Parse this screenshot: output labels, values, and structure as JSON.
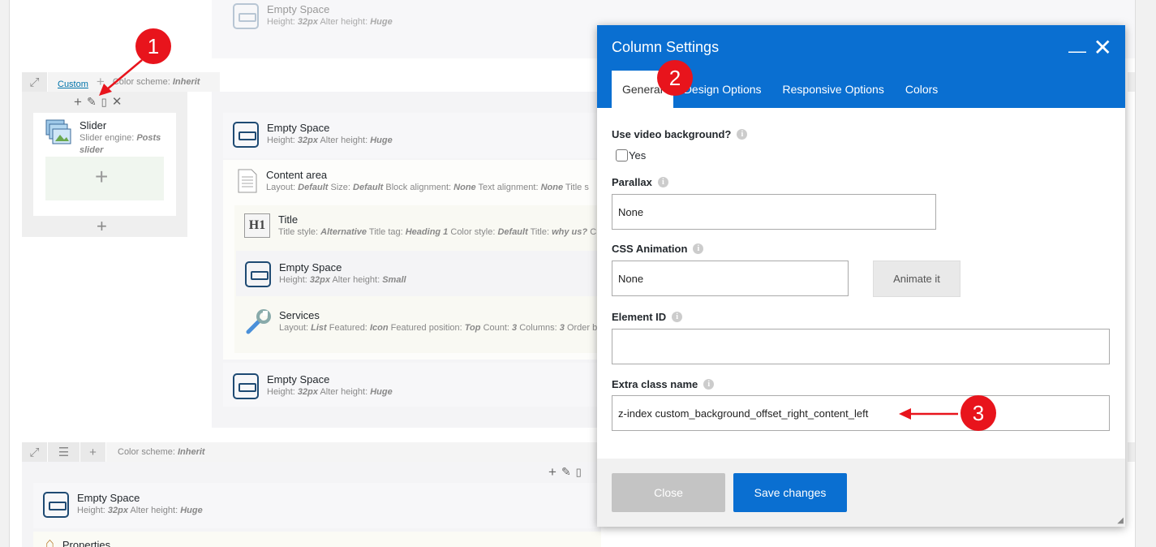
{
  "modal": {
    "title": "Column Settings",
    "tabs": [
      {
        "label": "General",
        "active": true
      },
      {
        "label": "Design Options",
        "active": false
      },
      {
        "label": "Responsive Options",
        "active": false
      },
      {
        "label": "Colors",
        "active": false
      }
    ],
    "fields": {
      "video_bg": {
        "label": "Use video background?",
        "checkbox_label": "Yes",
        "checked": false
      },
      "parallax": {
        "label": "Parallax",
        "value": "None"
      },
      "css_animation": {
        "label": "CSS Animation",
        "value": "None",
        "button": "Animate it"
      },
      "element_id": {
        "label": "Element ID",
        "value": ""
      },
      "extra_class": {
        "label": "Extra class name",
        "value": "z-index custom_background_offset_right_content_left"
      }
    },
    "footer": {
      "close_label": "Close",
      "save_label": "Save changes"
    },
    "header_color": "#0a6fd1"
  },
  "annotations": {
    "badge1": "1",
    "badge2": "2",
    "badge3": "3",
    "badge_color": "#e8141c"
  },
  "builder": {
    "row1": {
      "custom_link": "Custom",
      "color_scheme_label": "Color scheme:",
      "color_scheme_value": "Inherit"
    },
    "row2": {
      "color_scheme_label": "Color scheme:",
      "color_scheme_value": "Inherit"
    },
    "elements": {
      "es_top": {
        "title": "Empty Space",
        "p1k": "Height:",
        "p1v": "32px",
        "p2k": "Alter height:",
        "p2v": "Huge"
      },
      "slider": {
        "title": "Slider",
        "p1k": "Slider engine:",
        "p1v": "Posts",
        "p1v2": "slider"
      },
      "es_1": {
        "title": "Empty Space",
        "p1k": "Height:",
        "p1v": "32px",
        "p2k": "Alter height:",
        "p2v": "Huge"
      },
      "content_area": {
        "title": "Content area",
        "p1k": "Layout:",
        "p1v": "Default",
        "p2k": "Size:",
        "p2v": "Default",
        "p3k": "Block alignment:",
        "p3v": "None",
        "p4k": "Text alignment:",
        "p4v": "None",
        "p5k": "Title s"
      },
      "title": {
        "title": "Title",
        "p1k": "Title style:",
        "p1v": "Alternative",
        "p2k": "Title tag:",
        "p2v": "Heading 1",
        "p3k": "Color style:",
        "p3v": "Default",
        "p4k": "Title:",
        "p4v": "why us?",
        "p5k": "C"
      },
      "es_small": {
        "title": "Empty Space",
        "p1k": "Height:",
        "p1v": "32px",
        "p2k": "Alter height:",
        "p2v": "Small"
      },
      "services": {
        "title": "Services",
        "p1k": "Layout:",
        "p1v": "List",
        "p2k": "Featured:",
        "p2v": "Icon",
        "p3k": "Featured position:",
        "p3v": "Top",
        "p4k": "Count:",
        "p4v": "3",
        "p5k": "Columns:",
        "p5v": "3",
        "p6k": "Order b"
      },
      "es_2": {
        "title": "Empty Space",
        "p1k": "Height:",
        "p1v": "32px",
        "p2k": "Alter height:",
        "p2v": "Huge"
      },
      "es_3": {
        "title": "Empty Space",
        "p1k": "Height:",
        "p1v": "32px",
        "p2k": "Alter height:",
        "p2v": "Huge"
      },
      "properties": {
        "title": "Properties"
      }
    }
  }
}
